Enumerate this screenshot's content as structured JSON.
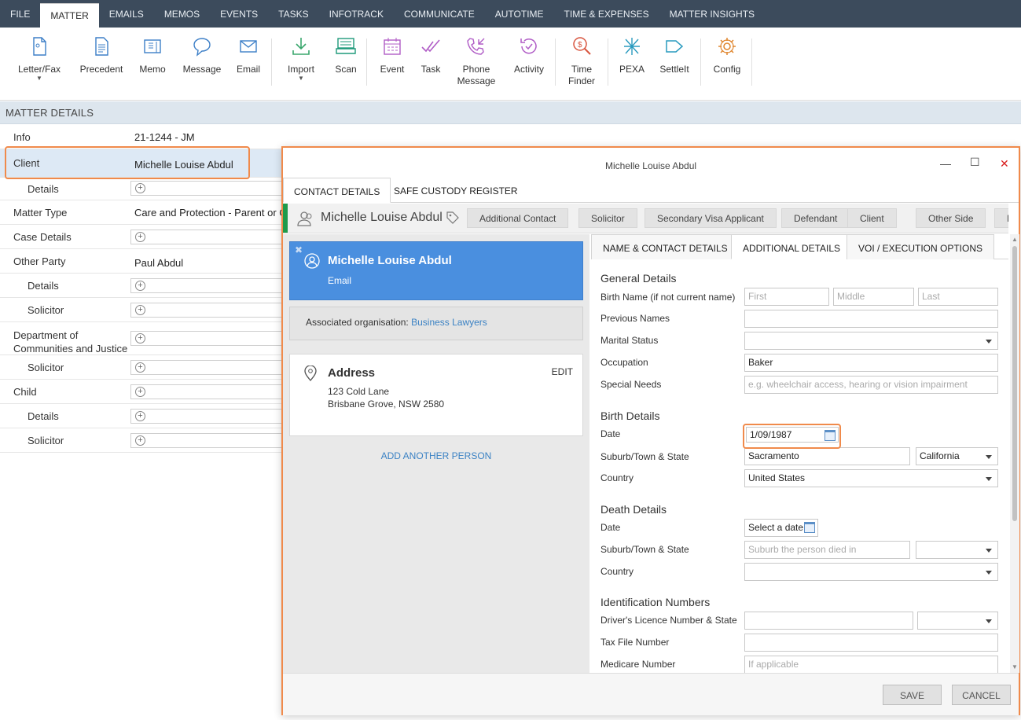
{
  "menu": [
    "FILE",
    "MATTER",
    "EMAILS",
    "MEMOS",
    "EVENTS",
    "TASKS",
    "INFOTRACK",
    "COMMUNICATE",
    "AUTOTIME",
    "TIME & EXPENSES",
    "MATTER INSIGHTS"
  ],
  "ribbon": {
    "letter_fax": "Letter/Fax",
    "precedent": "Precedent",
    "memo": "Memo",
    "message": "Message",
    "email": "Email",
    "import": "Import",
    "scan": "Scan",
    "event": "Event",
    "task": "Task",
    "phone_line1": "Phone",
    "phone_line2": "Message",
    "activity": "Activity",
    "time_line1": "Time",
    "time_line2": "Finder",
    "pexa": "PEXA",
    "settleit": "SettleIt",
    "config": "Config"
  },
  "matter_details": {
    "header": "MATTER DETAILS",
    "rows": [
      {
        "label": "Info",
        "value": "21-1244 - JM"
      },
      {
        "label": "Client",
        "value": "Michelle Louise Abdul"
      },
      {
        "label": "Details",
        "value": ""
      },
      {
        "label": "Matter Type",
        "value": "Care and Protection - Parent or C"
      },
      {
        "label": "Case Details",
        "value": ""
      },
      {
        "label": "Other Party",
        "value": "Paul Abdul"
      },
      {
        "label": "Details",
        "value": ""
      },
      {
        "label": "Solicitor",
        "value": ""
      },
      {
        "label_line1": "Department of",
        "label_line2": "Communities and Justice",
        "value": ""
      },
      {
        "label": "Solicitor",
        "value": ""
      },
      {
        "label": "Child",
        "value": ""
      },
      {
        "label": "Details",
        "value": ""
      },
      {
        "label": "Solicitor",
        "value": ""
      }
    ]
  },
  "dialog": {
    "title": "Michelle Louise Abdul",
    "tabs": [
      "CONTACT DETAILS",
      "SAFE CUSTODY REGISTER"
    ],
    "contact_name": "Michelle Louise Abdul",
    "roles": [
      "Additional Contact",
      "Solicitor",
      "Secondary Visa Applicant",
      "Defendant",
      "Client",
      "Other Side",
      "P"
    ],
    "person_card": {
      "name": "Michelle Louise Abdul",
      "sub": "Email"
    },
    "assoc_label": "Associated organisation:",
    "assoc_link": "Business Lawyers",
    "address": {
      "title": "Address",
      "line1": "123 Cold Lane",
      "line2": "Brisbane Grove, NSW 2580",
      "edit": "EDIT"
    },
    "add_person": "ADD ANOTHER PERSON",
    "subtabs": [
      "NAME & CONTACT DETAILS",
      "ADDITIONAL DETAILS",
      "VOI / EXECUTION OPTIONS"
    ],
    "form": {
      "general": "General Details",
      "birth_name_label": "Birth Name (if not current name)",
      "ph_first": "First",
      "ph_middle": "Middle",
      "ph_last": "Last",
      "previous_names_label": "Previous Names",
      "marital_label": "Marital Status",
      "occupation_label": "Occupation",
      "occupation_value": "Baker",
      "special_label": "Special Needs",
      "special_ph": "e.g. wheelchair access, hearing or vision impairment",
      "birth": "Birth Details",
      "birth_date_label": "Date",
      "birth_date_value": "1/09/1987",
      "birth_suburb_label": "Suburb/Town & State",
      "birth_suburb_value": "Sacramento",
      "birth_state_value": "California",
      "birth_country_label": "Country",
      "birth_country_value": "United States",
      "death": "Death Details",
      "death_date_label": "Date",
      "death_date_value": "Select a date",
      "death_suburb_label": "Suburb/Town & State",
      "death_suburb_ph": "Suburb the person died in",
      "death_country_label": "Country",
      "ident": "Identification Numbers",
      "licence_label": "Driver's Licence Number & State",
      "tfn_label": "Tax File Number",
      "medicare_label": "Medicare Number",
      "medicare_ph": "If applicable"
    },
    "save": "SAVE",
    "cancel": "CANCEL"
  },
  "colors": {
    "accent": "#4a8fdf",
    "highlight": "#f08a4b",
    "menubar": "#3c4b5c",
    "role_green": "#1e9a4b"
  }
}
